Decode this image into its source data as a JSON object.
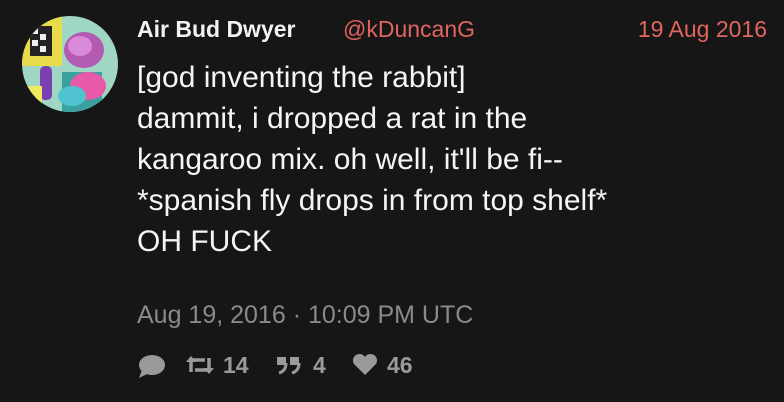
{
  "tweet": {
    "display_name": "Air Bud Dwyer",
    "handle": "@kDuncanG",
    "date": "19 Aug 2016",
    "lines": [
      "[god inventing the rabbit]",
      "dammit, i dropped a rat in the",
      "kangaroo mix. oh well, it'll be fi--",
      "*spanish fly drops in from top shelf*",
      "OH FUCK"
    ],
    "timestamp": "Aug 19, 2016 · 10:09 PM UTC",
    "stats": {
      "retweets": "14",
      "quotes": "4",
      "likes": "46"
    }
  },
  "colors": {
    "background": "#161616",
    "accent": "#e0655f",
    "muted": "#8a8a8a",
    "text": "#f5f5f5"
  },
  "icons": {
    "reply": "comment-icon",
    "retweet": "retweet-icon",
    "quote": "quote-icon",
    "like": "heart-icon"
  }
}
